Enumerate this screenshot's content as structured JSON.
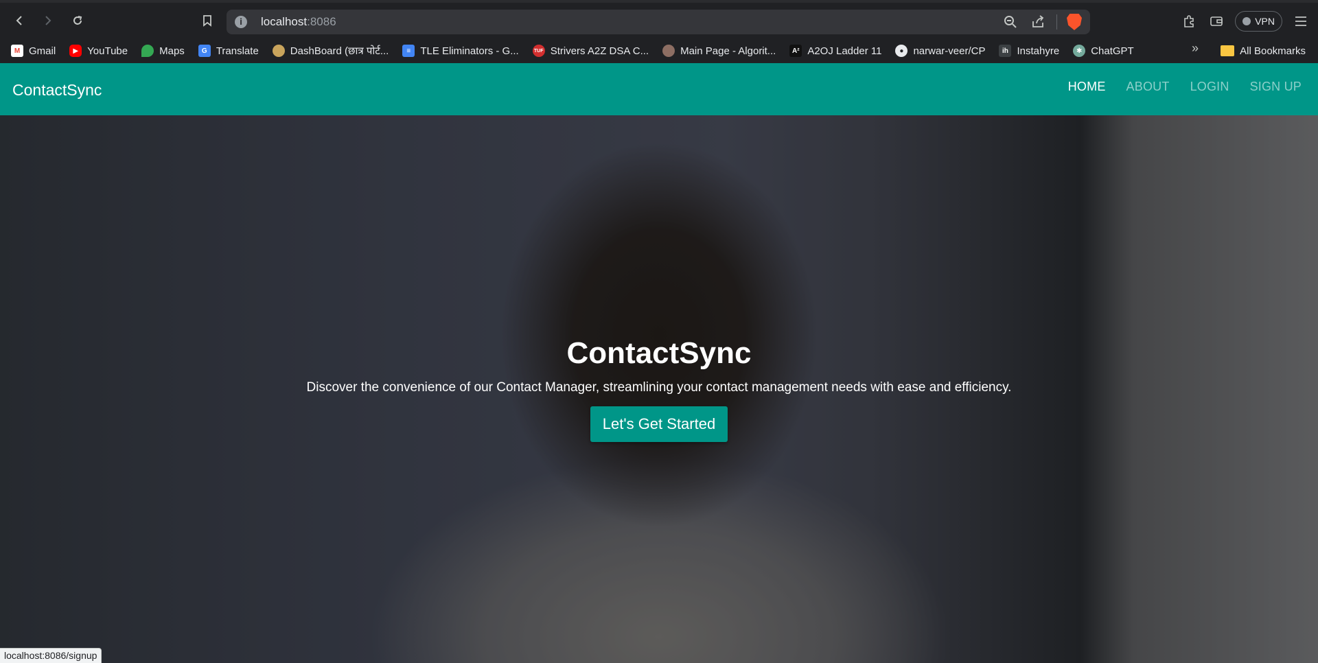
{
  "browser": {
    "url_host": "localhost",
    "url_port": ":8086",
    "vpn_label": "VPN",
    "status_url": "localhost:8086/signup"
  },
  "bookmarks": [
    {
      "label": "Gmail",
      "icon": "gmail-icon",
      "color": "#ea4335"
    },
    {
      "label": "YouTube",
      "icon": "youtube-icon",
      "color": "#ff0000"
    },
    {
      "label": "Maps",
      "icon": "maps-icon",
      "color": "#34a853"
    },
    {
      "label": "Translate",
      "icon": "translate-icon",
      "color": "#4285f4"
    },
    {
      "label": "DashBoard (छात्र पोर्ट...",
      "icon": "dashboard-icon",
      "color": "#c9a45c"
    },
    {
      "label": "TLE Eliminators - G...",
      "icon": "docs-icon",
      "color": "#4285f4"
    },
    {
      "label": "Strivers A2Z DSA C...",
      "icon": "tuf-icon",
      "color": "#d32f2f"
    },
    {
      "label": "Main Page - Algorit...",
      "icon": "algorithmica-icon",
      "color": "#8d6e63"
    },
    {
      "label": "A2OJ Ladder 11",
      "icon": "a2oj-icon",
      "color": "#111111"
    },
    {
      "label": "narwar-veer/CP",
      "icon": "github-icon",
      "color": "#e8eaed"
    },
    {
      "label": "Instahyre",
      "icon": "instahyre-icon",
      "color": "#3c4043"
    },
    {
      "label": "ChatGPT",
      "icon": "chatgpt-icon",
      "color": "#74aa9c"
    }
  ],
  "bookmarks_more": "»",
  "bookmarks_all": "All Bookmarks",
  "app": {
    "brand": "ContactSync",
    "menu": [
      "HOME",
      "ABOUT",
      "LOGIN",
      "SIGN UP"
    ],
    "accent_color": "#009688"
  },
  "hero": {
    "title": "ContactSync",
    "subtitle": "Discover the convenience of our Contact Manager, streamlining your contact management needs with ease and efficiency.",
    "cta": "Let's Get Started"
  }
}
